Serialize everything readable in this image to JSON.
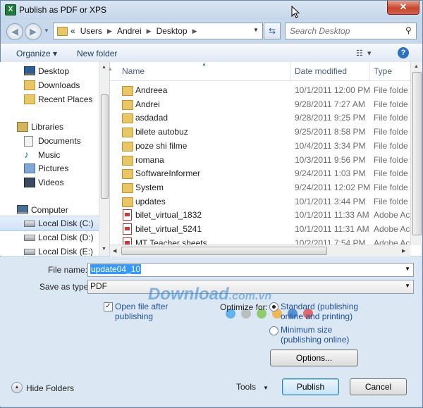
{
  "window": {
    "title": "Publish as PDF or XPS",
    "close_glyph": "✕"
  },
  "address": {
    "crumbs": [
      "«",
      "Users",
      "Andrei",
      "Desktop"
    ],
    "search_placeholder": "Search Desktop"
  },
  "toolbar": {
    "organize": "Organize ▾",
    "new_folder": "New folder"
  },
  "nav": {
    "items": [
      {
        "label": "Desktop",
        "icon": "desktop-icon"
      },
      {
        "label": "Downloads",
        "icon": "folder-icon"
      },
      {
        "label": "Recent Places",
        "icon": "recent-places-icon"
      },
      {
        "label": "Libraries",
        "icon": "libraries-icon"
      },
      {
        "label": "Documents",
        "icon": "documents-icon"
      },
      {
        "label": "Music",
        "icon": "music-icon"
      },
      {
        "label": "Pictures",
        "icon": "pictures-icon"
      },
      {
        "label": "Videos",
        "icon": "videos-icon"
      },
      {
        "label": "Computer",
        "icon": "computer-icon"
      },
      {
        "label": "Local Disk (C:)",
        "icon": "disk-icon"
      },
      {
        "label": "Local Disk (D:)",
        "icon": "disk-icon"
      },
      {
        "label": "Local Disk (E:)",
        "icon": "disk-icon"
      }
    ]
  },
  "files": {
    "columns": {
      "name": "Name",
      "date": "Date modified",
      "type": "Type"
    },
    "rows": [
      {
        "name": "Andreea",
        "date": "10/1/2011 12:00 PM",
        "type": "File folde",
        "kind": "folder"
      },
      {
        "name": "Andrei",
        "date": "9/28/2011 7:27 AM",
        "type": "File folde",
        "kind": "folder"
      },
      {
        "name": "asdadad",
        "date": "9/28/2011 9:25 PM",
        "type": "File folde",
        "kind": "folder"
      },
      {
        "name": "bilete autobuz",
        "date": "9/25/2011 8:58 PM",
        "type": "File folde",
        "kind": "folder"
      },
      {
        "name": "poze shi filme",
        "date": "10/4/2011 3:34 PM",
        "type": "File folde",
        "kind": "folder"
      },
      {
        "name": "romana",
        "date": "10/3/2011 9:56 PM",
        "type": "File folde",
        "kind": "folder"
      },
      {
        "name": "SoftwareInformer",
        "date": "9/24/2011 1:03 PM",
        "type": "File folde",
        "kind": "folder"
      },
      {
        "name": "System",
        "date": "9/24/2011 12:02 PM",
        "type": "File folde",
        "kind": "folder"
      },
      {
        "name": "updates",
        "date": "10/1/2011 3:44 PM",
        "type": "File folde",
        "kind": "folder"
      },
      {
        "name": "bilet_virtual_1832",
        "date": "10/1/2011 11:33 AM",
        "type": "Adobe Ac",
        "kind": "pdf"
      },
      {
        "name": "bilet_virtual_5241",
        "date": "10/1/2011 11:31 AM",
        "type": "Adobe Ac",
        "kind": "pdf"
      },
      {
        "name": "MT Teacher sheets",
        "date": "10/2/2011 7:54 PM",
        "type": "Adobe Ac",
        "kind": "pdf"
      }
    ]
  },
  "form": {
    "filename_label": "File name:",
    "filename_value": "update04_10",
    "saveas_label": "Save as type:",
    "saveas_value": "PDF",
    "open_file_line1": "Open file after",
    "open_file_line2": "publishing",
    "optimize_label": "Optimize for:",
    "standard_line1": "Standard (publishing",
    "standard_line2": "online and printing)",
    "minimum_line1": "Minimum size",
    "minimum_line2": "(publishing online)",
    "options": "Options...",
    "hide_folders": "Hide Folders",
    "tools": "Tools",
    "publish": "Publish",
    "cancel": "Cancel"
  },
  "watermark": {
    "main": "Download",
    "suffix": ".com.vn"
  },
  "colors": {
    "accent": "#2f6fc4",
    "selection": "#3399ff"
  }
}
